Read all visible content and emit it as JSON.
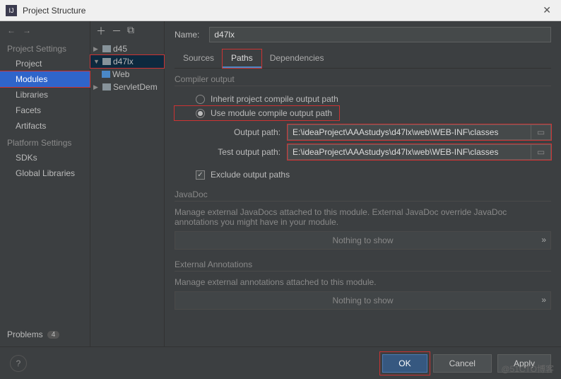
{
  "window": {
    "title": "Project Structure"
  },
  "sidebar": {
    "section1": "Project Settings",
    "items1": [
      "Project",
      "Modules",
      "Libraries",
      "Facets",
      "Artifacts"
    ],
    "section2": "Platform Settings",
    "items2": [
      "SDKs",
      "Global Libraries"
    ],
    "problems": "Problems",
    "problems_count": "4"
  },
  "tree": {
    "items": [
      {
        "label": "d45",
        "expanded": false,
        "indent": 0
      },
      {
        "label": "d47lx",
        "expanded": true,
        "indent": 0,
        "selected": true,
        "redbox": true
      },
      {
        "label": "Web",
        "indent": 1,
        "webicon": true
      },
      {
        "label": "ServletDem",
        "indent": 0,
        "expanded": false
      }
    ]
  },
  "main": {
    "name_label": "Name:",
    "name_value": "d47lx",
    "tabs": [
      "Sources",
      "Paths",
      "Dependencies"
    ],
    "active_tab": 1,
    "compiler_label": "Compiler output",
    "radio1": "Inherit project compile output path",
    "radio2": "Use module compile output path",
    "output_label": "Output path:",
    "output_value": "E:\\ideaProject\\AAAstudys\\d47lx\\web\\WEB-INF\\classes",
    "test_label": "Test output path:",
    "test_value": "E:\\ideaProject\\AAAstudys\\d47lx\\web\\WEB-INF\\classes",
    "exclude_label": "Exclude output paths",
    "javadoc_label": "JavaDoc",
    "javadoc_desc": "Manage external JavaDocs attached to this module. External JavaDoc override JavaDoc annotations you might have in your module.",
    "nothing": "Nothing to show",
    "annot_label": "External Annotations",
    "annot_desc": "Manage external annotations attached to this module."
  },
  "footer": {
    "ok": "OK",
    "cancel": "Cancel",
    "apply": "Apply"
  },
  "watermark": "@51CTO博客"
}
